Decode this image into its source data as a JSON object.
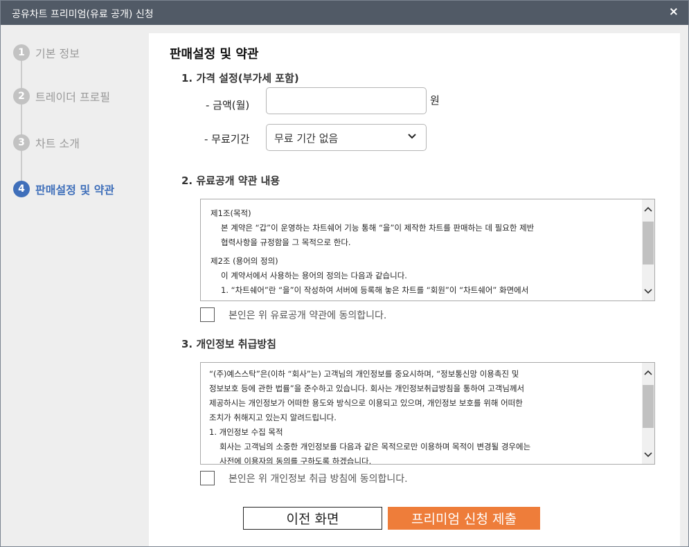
{
  "window": {
    "title": "공유차트 프리미엄(유료 공개) 신청",
    "close_glyph": "×"
  },
  "steps": [
    {
      "number": "1",
      "label": "기본 정보",
      "active": false
    },
    {
      "number": "2",
      "label": "트레이더 프로필",
      "active": false
    },
    {
      "number": "3",
      "label": "차트 소개",
      "active": false
    },
    {
      "number": "4",
      "label": "판매설정 및 약관",
      "active": true
    }
  ],
  "main": {
    "page_title": "판매설정 및 약관",
    "price": {
      "heading": "1. 가격 설정(부가세 포함)",
      "amount_label": "- 금액(월)",
      "amount_value": "",
      "amount_unit": "원",
      "free_label": "- 무료기간",
      "free_selected": "무료 기간 없음"
    },
    "paid_terms": {
      "heading": "2. 유료공개 약관 내용",
      "lines": [
        "제1조(목적)",
        "본 계약은 “갑”이 운영하는 차트쉐어 기능 통해 “을”이 제작한 차트를 판매하는 데 필요한 제반",
        "협력사항을 규정함을 그 목적으로 한다.",
        "제2조 (용어의 정의)",
        "이 계약서에서 사용하는 용어의 정의는 다음과 같습니다.",
        "1. “차트쉐어”란 “을”이 작성하여 서버에 등록해 놓은 차트를 “회원”이 “차트쉐어” 화면에서"
      ],
      "agree_text": "본인은 위 유료공개 약관에 동의합니다."
    },
    "privacy": {
      "heading": "3. 개인정보 취급방침",
      "lines": [
        "“(주)예스스탁”은(이하 “회사”는) 고객님의 개인정보를 중요시하며, “정보통신망 이용촉진 및",
        "정보보호 등에 관한 법률”을 준수하고 있습니다. 회사는 개인정보취급방침을 통하여 고객님께서",
        "제공하시는 개인정보가 어떠한 용도와 방식으로 이용되고 있으며, 개인정보 보호를 위해 어떠한",
        "조치가 취해지고 있는지 알려드립니다.",
        "1. 개인정보 수집 목적",
        "회사는 고객님의 소중한 개인정보를 다음과 같은 목적으로만 이용하며 목적이 변경될 경우에는",
        "사전에 이용자의 동의를 구하도록 하겠습니다."
      ],
      "agree_text": "본인은 위 개인정보 취급 방침에 동의합니다."
    },
    "buttons": {
      "prev_label": "이전 화면",
      "submit_label": "프리미엄 신청 제출"
    }
  },
  "colors": {
    "titlebar": "#515a66",
    "active_step": "#3f6fba",
    "inactive_step": "#c2c2c2",
    "submit": "#ee7d3a"
  },
  "icons": {
    "close": "close-icon",
    "select": "chevron-down-icon",
    "scroll_up": "chevron-up-icon",
    "scroll_down": "chevron-down-icon"
  }
}
